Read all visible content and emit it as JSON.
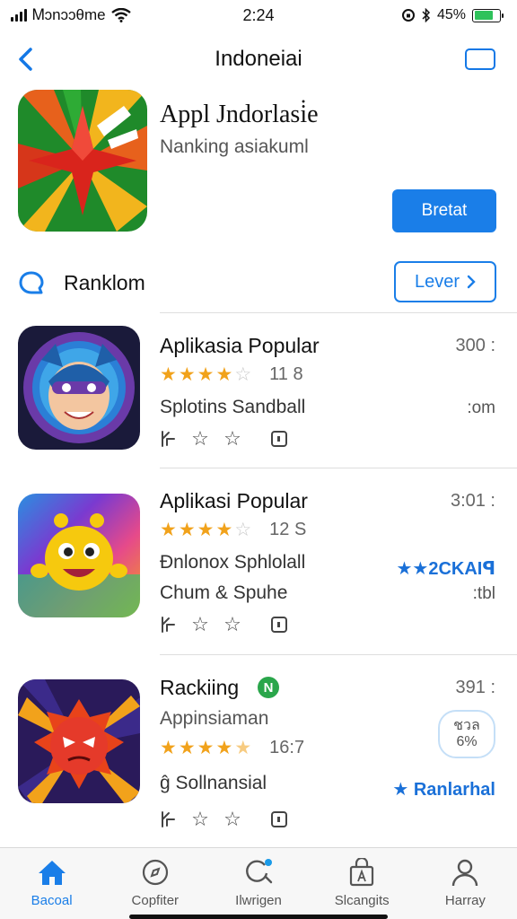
{
  "status_bar": {
    "carrier": "Ꮇɔnɔɔθme",
    "time": "2:24",
    "battery_percent": "45%",
    "battery_level": 0.75,
    "battery_color": "#2fc25b"
  },
  "nav": {
    "title": "Indoneiai"
  },
  "hero": {
    "title": "Appl Jndorlasi̇e",
    "subtitle": "Nanking asiakuml",
    "button_label": "Bretat"
  },
  "section": {
    "title": "Ranklom",
    "more_label": "Lever"
  },
  "apps": [
    {
      "name": "Aplikasia Popular",
      "size": "300 :",
      "rating": 4,
      "half_star": false,
      "rating_count": "11 8",
      "desc": "Splotins Sandball",
      "unit": ":om",
      "icon": "superhero-cat-icon"
    },
    {
      "name": "Aplikasi Popular",
      "size": "3:01 :",
      "rating": 4,
      "half_star": false,
      "rating_count": "12 S",
      "desc": "Ðnlonox Sphlolall",
      "desc2": "Chum & Spuhe",
      "unit": ":tbl",
      "tag": "★★2CKAIꟼ",
      "icon": "yellow-monster-icon"
    },
    {
      "name": "Rackiing",
      "size": "391 :",
      "rating": 4,
      "half_star": true,
      "rating_count": "16:7",
      "desc": "Appinsiaman",
      "desc2": "ĝ  Sollnansial",
      "badge_text": "N",
      "percent_line1": "ชวล",
      "percent_line2": "6%",
      "tag": "★ Ranlarhal",
      "icon": "red-spiky-creature-icon"
    }
  ],
  "tabs": [
    {
      "label": "Bacoal",
      "icon": "home-icon"
    },
    {
      "label": "Copfiter",
      "icon": "compass-icon"
    },
    {
      "label": "Ilwrigen",
      "icon": "search-icon"
    },
    {
      "label": "Slcangits",
      "icon": "bag-icon"
    },
    {
      "label": "Harray",
      "icon": "person-icon"
    }
  ],
  "colors": {
    "accent": "#1a7ee8",
    "star": "#f1a21b"
  }
}
